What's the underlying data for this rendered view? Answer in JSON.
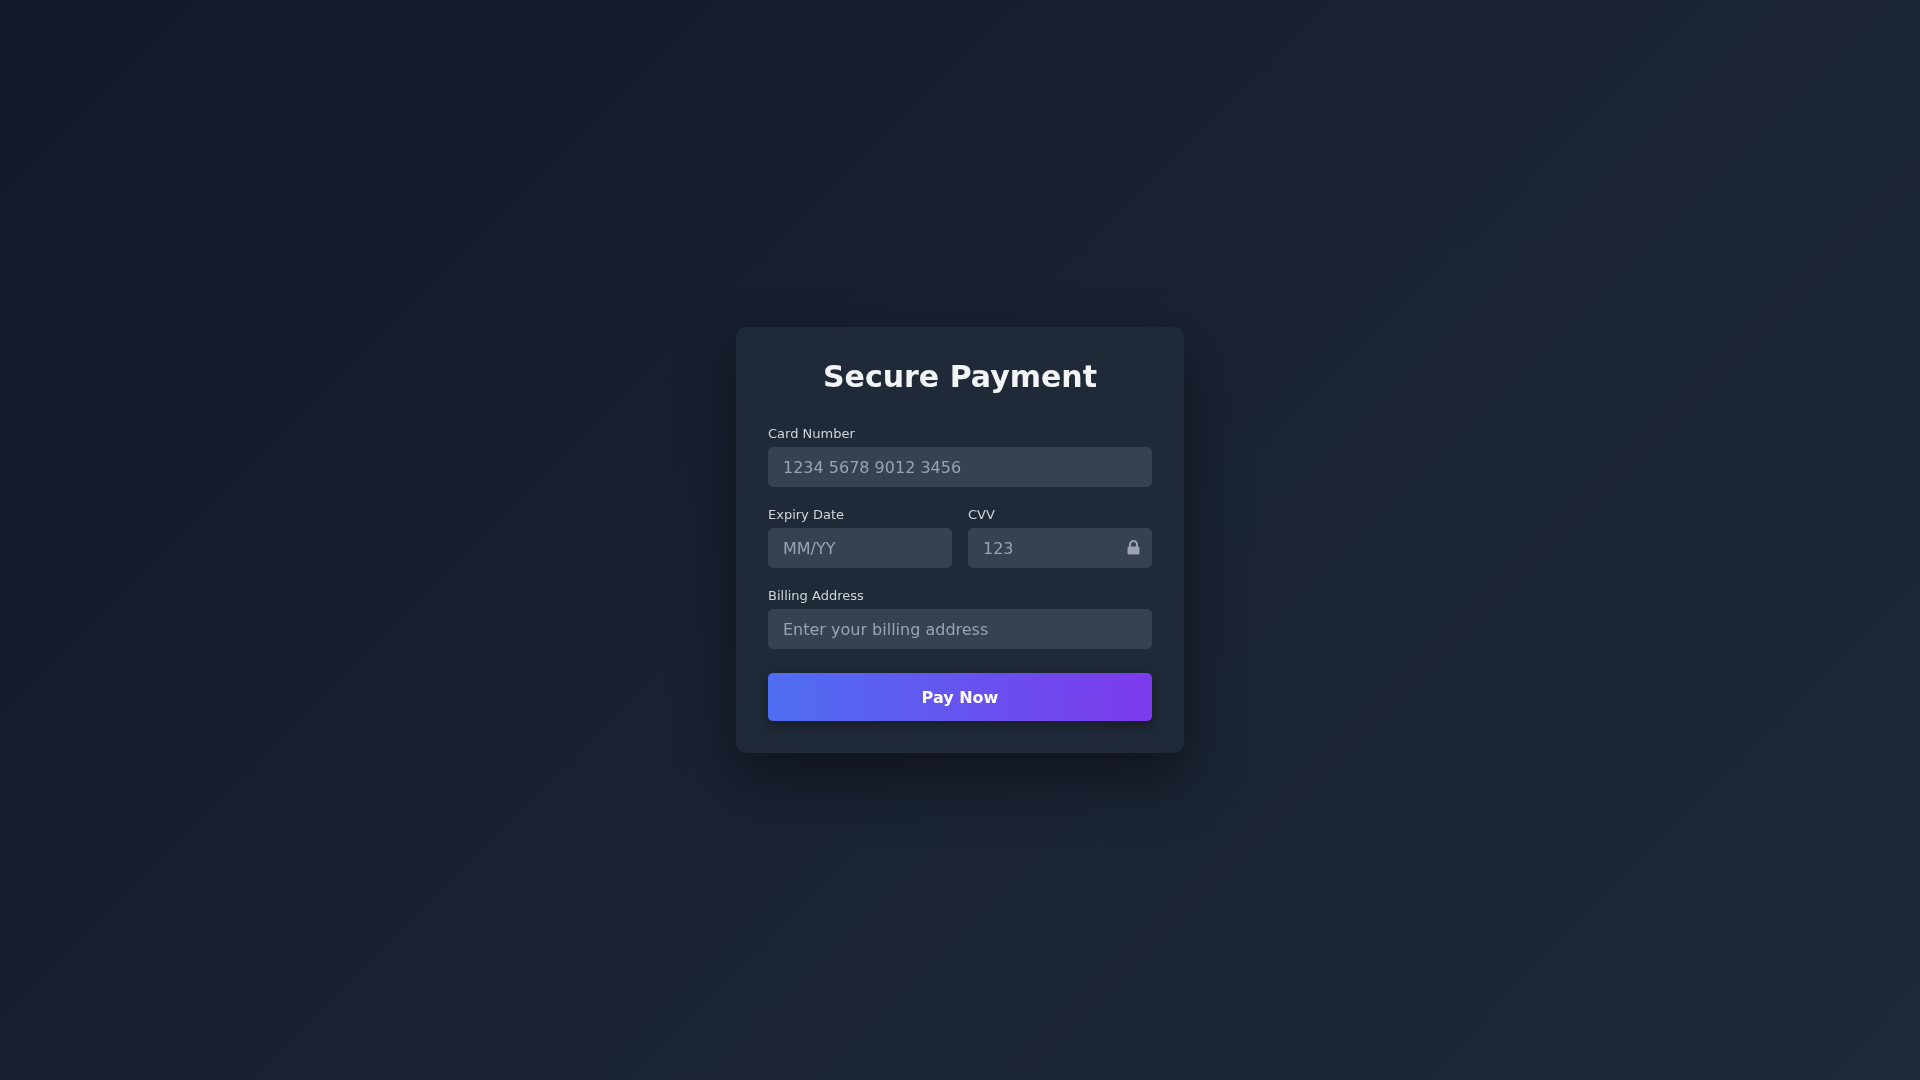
{
  "title": "Secure Payment",
  "fields": [
    {
      "label": "Card Number",
      "placeholder": "1234 5678 9012 3456",
      "kind": "full"
    },
    {
      "label": "Expiry Date",
      "placeholder": "MM/YY",
      "kind": "half"
    },
    {
      "label": "CVV",
      "placeholder": "123",
      "kind": "half-lock"
    },
    {
      "label": "Billing Address",
      "placeholder": "Enter your billing address",
      "kind": "full"
    }
  ],
  "button": "Pay Now"
}
